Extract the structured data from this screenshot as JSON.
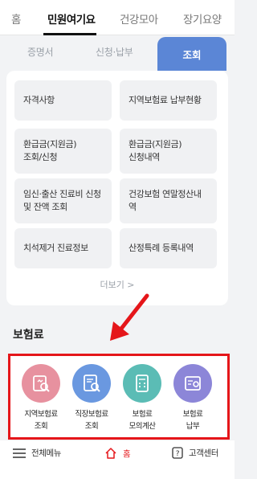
{
  "top_nav": {
    "tabs": [
      "홈",
      "민원여기요",
      "건강모아",
      "장기요양"
    ],
    "active": "민원여기요"
  },
  "sub_tabs": {
    "items": [
      "증명서",
      "신청·납부",
      "조회"
    ],
    "active": "조회"
  },
  "inquiry_menu": {
    "items": [
      "자격사항",
      "지역보험료 납부현황",
      "환급금(지원금)\n조회/신청",
      "환급금(지원금)\n신청내역",
      "임신·출산 진료비 신청\n및 잔액 조회",
      "건강보험 연말정산내역",
      "치석제거 진료정보",
      "산정특례 등록내역"
    ],
    "more_label": "더보기 >"
  },
  "premium_section": {
    "title": "보험료",
    "items": [
      {
        "label": "지역보험료\n조회",
        "icon": "regional-premium-icon",
        "color": "#e7919f"
      },
      {
        "label": "직장보험료\n조회",
        "icon": "workplace-premium-icon",
        "color": "#6a98e0"
      },
      {
        "label": "보험료\n모의계산",
        "icon": "calculator-icon",
        "color": "#5bbcb5"
      },
      {
        "label": "보험료\n납부",
        "icon": "payment-icon",
        "color": "#8c86d8"
      }
    ]
  },
  "bottom_bar": {
    "menu_label": "전체메뉴",
    "home_label": "홈",
    "support_label": "고객센터"
  },
  "colors": {
    "accent": "#5b86d6",
    "highlight": "#e5161a"
  }
}
